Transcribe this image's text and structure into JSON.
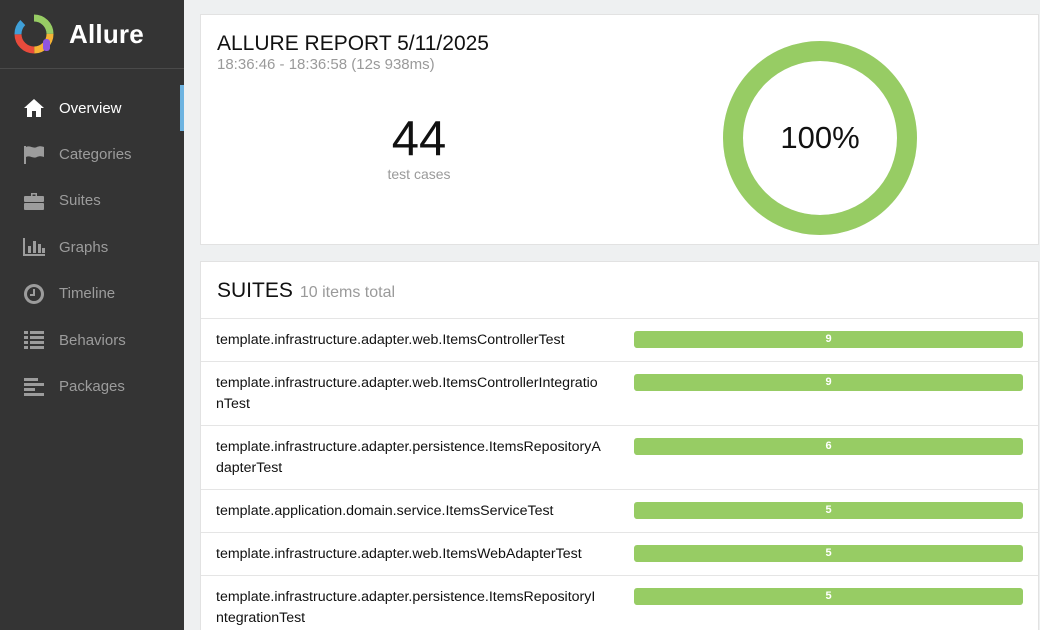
{
  "brand": {
    "name": "Allure"
  },
  "sidebar": {
    "items": [
      {
        "label": "Overview",
        "icon": "home-icon",
        "active": true
      },
      {
        "label": "Categories",
        "icon": "flag-icon"
      },
      {
        "label": "Suites",
        "icon": "briefcase-icon"
      },
      {
        "label": "Graphs",
        "icon": "bar-chart-icon"
      },
      {
        "label": "Timeline",
        "icon": "clock-icon"
      },
      {
        "label": "Behaviors",
        "icon": "list-icon"
      },
      {
        "label": "Packages",
        "icon": "align-left-icon"
      }
    ]
  },
  "summary": {
    "title": "ALLURE REPORT 5/11/2025",
    "time": "18:36:46 - 18:36:58 (12s 938ms)",
    "count": "44",
    "count_label": "test cases",
    "percent_label": "100%",
    "passed_fraction": 1.0
  },
  "suites": {
    "title": "SUITES",
    "count_label": "10 items total",
    "rows": [
      {
        "name": "template.infrastructure.adapter.web.ItemsControllerTest",
        "value": "9"
      },
      {
        "name": "template.infrastructure.adapter.web.ItemsControllerIntegrationTest",
        "value": "9"
      },
      {
        "name": "template.infrastructure.adapter.persistence.ItemsRepositoryAdapterTest",
        "value": "6"
      },
      {
        "name": "template.application.domain.service.ItemsServiceTest",
        "value": "5"
      },
      {
        "name": "template.infrastructure.adapter.web.ItemsWebAdapterTest",
        "value": "5"
      },
      {
        "name": "template.infrastructure.adapter.persistence.ItemsRepositoryIntegrationTest",
        "value": "5"
      }
    ]
  },
  "colors": {
    "sidebar_bg": "#343434",
    "active_indicator": "#6db3e0",
    "passed": "#97cc64"
  }
}
